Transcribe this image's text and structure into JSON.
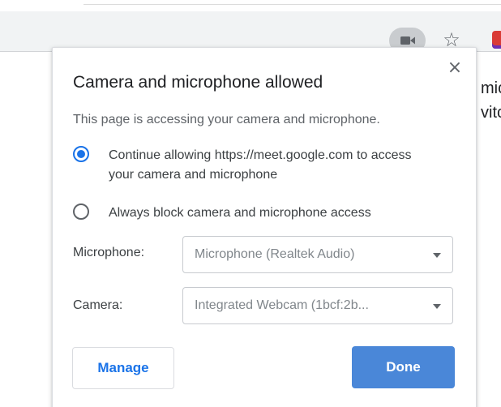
{
  "browser": {
    "star_glyph": "☆",
    "camera_icon": "video-camera-icon",
    "extension_icon": "extension-icon"
  },
  "background_page": {
    "text_fragments": [
      "mic",
      "vitc"
    ]
  },
  "popup": {
    "close_glyph": "×",
    "title": "Camera and microphone allowed",
    "subtitle": "This page is accessing your camera and microphone.",
    "options": [
      {
        "label": "Continue allowing https://meet.google.com to access your camera and microphone",
        "checked": true
      },
      {
        "label": "Always block camera and microphone access",
        "checked": false
      }
    ],
    "microphone": {
      "label": "Microphone:",
      "value": "Microphone (Realtek Audio)"
    },
    "camera": {
      "label": "Camera:",
      "value": "Integrated Webcam (1bcf:2b..."
    },
    "manage_label": "Manage",
    "done_label": "Done"
  },
  "colors": {
    "accent": "#1a73e8",
    "done_button": "#4a87d8",
    "toolbar": "#f1f3f4"
  }
}
